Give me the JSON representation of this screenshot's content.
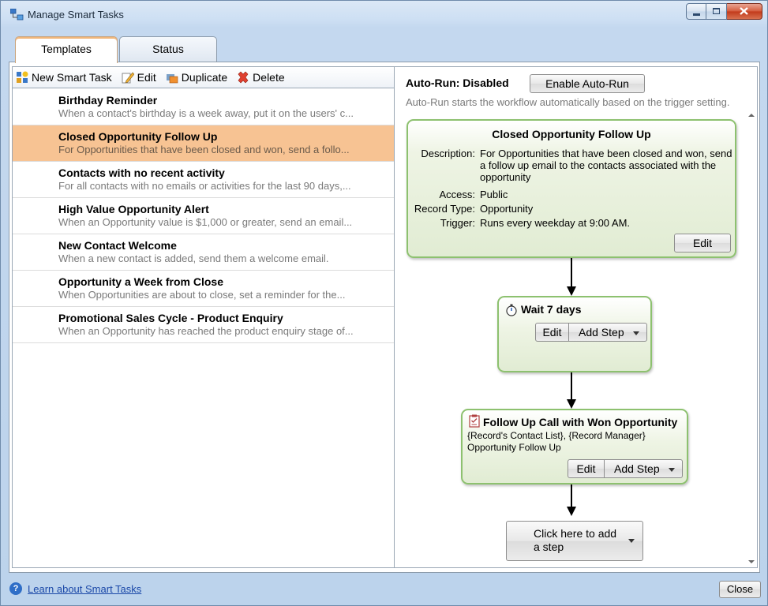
{
  "window": {
    "title": "Manage Smart Tasks",
    "icon": "smart-tasks-app-icon"
  },
  "tabs": [
    {
      "label": "Templates",
      "active": true
    },
    {
      "label": "Status",
      "active": false
    }
  ],
  "toolbar": {
    "new_label": "New Smart Task",
    "edit_label": "Edit",
    "duplicate_label": "Duplicate",
    "delete_label": "Delete"
  },
  "templates": [
    {
      "title": "Birthday Reminder",
      "desc": "When a contact's birthday is a week away, put it on the users' c...",
      "selected": false
    },
    {
      "title": "Closed Opportunity Follow Up",
      "desc": "For Opportunities that have been closed and won, send a follo...",
      "selected": true
    },
    {
      "title": "Contacts with no recent activity",
      "desc": "For all contacts with no emails or activities for the last 90 days,...",
      "selected": false
    },
    {
      "title": "High Value Opportunity Alert",
      "desc": "When an Opportunity value is $1,000 or greater, send an email...",
      "selected": false
    },
    {
      "title": "New Contact Welcome",
      "desc": "When a new contact is added, send them a welcome email.",
      "selected": false
    },
    {
      "title": "Opportunity a Week from Close",
      "desc": "When Opportunities are about to close, set a reminder for the...",
      "selected": false
    },
    {
      "title": "Promotional Sales Cycle - Product Enquiry",
      "desc": "When an Opportunity has reached the product enquiry stage of...",
      "selected": false
    }
  ],
  "autorun": {
    "status_label": "Auto-Run: Disabled",
    "enable_button": "Enable Auto-Run",
    "description": "Auto-Run starts the workflow automatically based on the trigger setting."
  },
  "workflow": {
    "header": {
      "title": "Closed Opportunity Follow Up",
      "description_key": "Description:",
      "description_val": "For Opportunities that have been closed and won, send a follow up email to the contacts associated with the opportunity",
      "access_key": "Access:",
      "access_val": "Public",
      "record_type_key": "Record Type:",
      "record_type_val": "Opportunity",
      "trigger_key": "Trigger:",
      "trigger_val": "Runs every weekday at 9:00 AM.",
      "edit_button": "Edit"
    },
    "wait_step": {
      "title": "Wait 7 days",
      "edit_button": "Edit",
      "add_step_button": "Add Step"
    },
    "call_step": {
      "title": "Follow Up Call with Won Opportunity",
      "line1": "{Record's Contact List}, {Record Manager}",
      "line2": "Opportunity Follow Up",
      "edit_button": "Edit",
      "add_step_button": "Add Step"
    },
    "add_step_placeholder": {
      "line1": "Click here to add",
      "line2": "a step"
    }
  },
  "footer": {
    "help_link": "Learn about Smart Tasks",
    "close_button": "Close"
  }
}
